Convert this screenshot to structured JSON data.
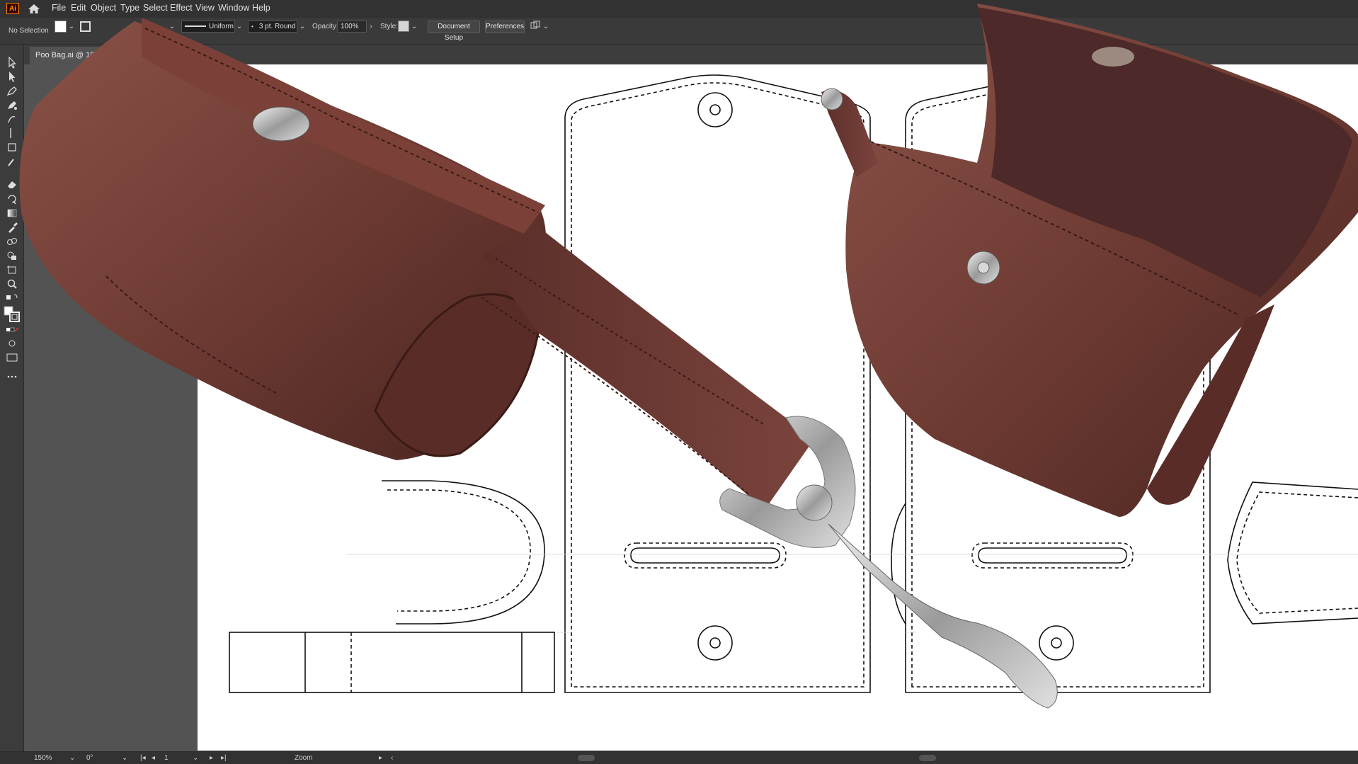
{
  "app": {
    "logo_text": "Ai"
  },
  "menu": [
    "File",
    "Edit",
    "Object",
    "Type",
    "Select",
    "Effect",
    "View",
    "Window",
    "Help"
  ],
  "control_bar": {
    "selection": "No Selection",
    "stroke_profile": "Uniform",
    "brush": "3 pt. Round",
    "opacity_label": "Opacity:",
    "opacity_value": "100%",
    "style_label": "Style:",
    "document_setup": "Document Setup",
    "preferences": "Preferences"
  },
  "document": {
    "tab_title": "Poo Bag.ai @ 150"
  },
  "status_bar": {
    "zoom": "150%",
    "rotation": "0°",
    "artboard": "1",
    "tool": "Zoom"
  },
  "colors": {
    "leather": "#6e3b33",
    "leather_dark": "#4a2420",
    "ui_bg": "#535353",
    "menu_bg": "#323232",
    "metal": "#c9c9c9"
  },
  "icons": [
    "home-icon",
    "selection-tool-icon",
    "direct-selection-tool-icon",
    "pen-tool-icon",
    "curvature-tool-icon",
    "eraser-tool-icon",
    "rotate-tool-icon",
    "gradient-tool-icon",
    "eyedropper-tool-icon",
    "blend-tool-icon",
    "shape-builder-tool-icon",
    "artboard-tool-icon",
    "zoom-tool-icon",
    "fill-stroke-icon",
    "more-tools-icon"
  ]
}
